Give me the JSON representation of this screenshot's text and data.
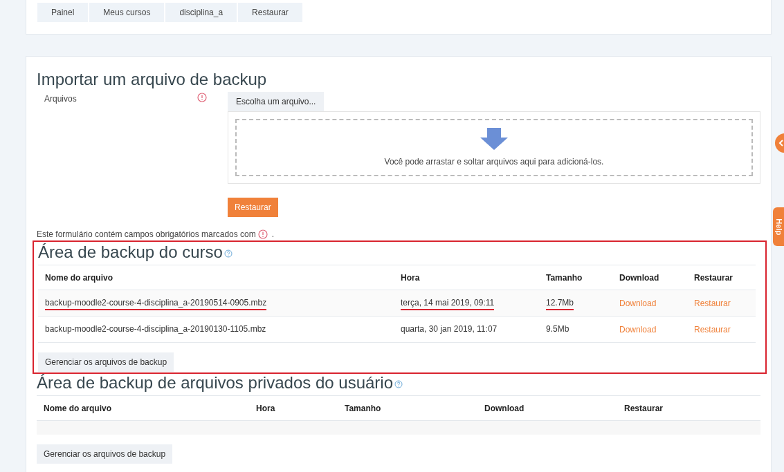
{
  "breadcrumb": [
    {
      "label": "Painel"
    },
    {
      "label": "Meus cursos"
    },
    {
      "label": "disciplina_a"
    },
    {
      "label": "Restaurar"
    }
  ],
  "import": {
    "title": "Importar um arquivo de backup",
    "field_label": "Arquivos",
    "required": true,
    "choose_button": "Escolha um arquivo...",
    "dropzone_text": "Você pode arrastar e soltar arquivos aqui para adicioná-los.",
    "submit": "Restaurar",
    "required_note": "Este formulário contém campos obrigatórios marcados com",
    "required_note_end": "."
  },
  "course_backup": {
    "title": "Área de backup do curso",
    "highlighted": true,
    "columns": [
      "Nome do arquivo",
      "Hora",
      "Tamanho",
      "Download",
      "Restaurar"
    ],
    "rows": [
      {
        "name": "backup-moodle2-course-4-disciplina_a-20190514-0905.mbz",
        "time": "terça, 14 mai 2019, 09:11",
        "size": "12.7Mb",
        "download": "Download",
        "restore": "Restaurar",
        "underlined": true
      },
      {
        "name": "backup-moodle2-course-4-disciplina_a-20190130-1105.mbz",
        "time": "quarta, 30 jan 2019, 11:07",
        "size": "9.5Mb",
        "download": "Download",
        "restore": "Restaurar",
        "underlined": false
      }
    ],
    "manage_button": "Gerenciar os arquivos de backup"
  },
  "user_backup": {
    "title": "Área de backup de arquivos privados do usuário",
    "columns": [
      "Nome do arquivo",
      "Hora",
      "Tamanho",
      "Download",
      "Restaurar"
    ],
    "manage_button": "Gerenciar os arquivos de backup"
  },
  "help_tab": "Help"
}
